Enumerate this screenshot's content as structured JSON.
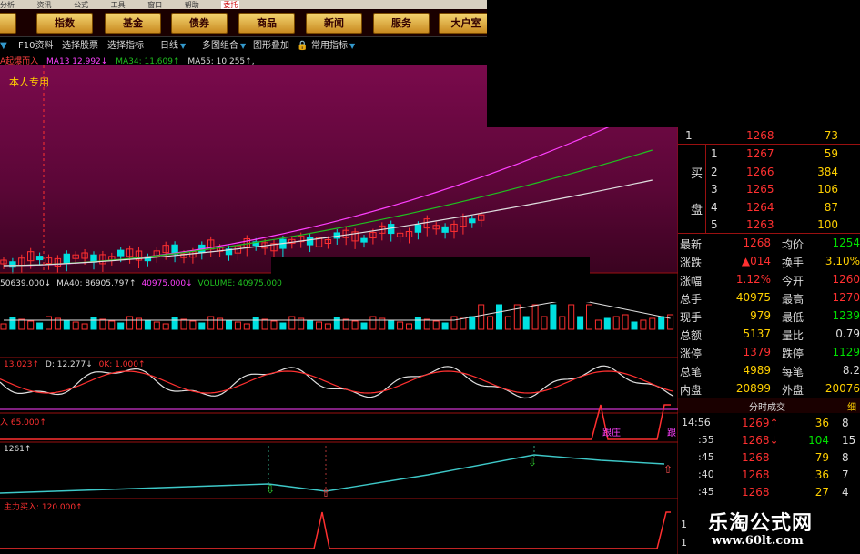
{
  "menu": [
    "分析",
    "资讯",
    "公式",
    "工具",
    "窗口",
    "帮助"
  ],
  "menu_badge": "委托",
  "nav": [
    "",
    "指数",
    "基金",
    "债券",
    "商品",
    "新闻",
    "服务",
    "大户室"
  ],
  "toolbar": {
    "items": [
      "F10资料",
      "选择股票",
      "选择指标",
      "日线",
      "多图组合",
      "图形叠加",
      "常用指标"
    ]
  },
  "main_info": {
    "formula": "A起爆而入",
    "ma13": "MA13  12.992↓",
    "ma34": "MA34: 11.609↑",
    "ma55": "MA55: 10.255↑,"
  },
  "main_label": "本人专用",
  "volume_info": {
    "a": "50639.000↓",
    "ma40": "MA40: 86905.797↑",
    "c": "40975.000↓",
    "vol": "VOLUME: 40975.000"
  },
  "kdj_info": {
    "k": "13.023↑",
    "d": "D: 12.277↓",
    "j": "0K: 1.000↑"
  },
  "ind3_info": "入  65.000↑",
  "ind3_labels": [
    "跟庄",
    "跟"
  ],
  "ind4_info": "1261↑",
  "ind5_info": "主力买入: 120.000↑",
  "order_book": {
    "buy_label": [
      "买",
      "盘"
    ],
    "top_row": {
      "level": "1",
      "price": "1268",
      "vol": "73"
    },
    "buys": [
      {
        "level": "1",
        "price": "1267",
        "vol": "59"
      },
      {
        "level": "2",
        "price": "1266",
        "vol": "384"
      },
      {
        "level": "3",
        "price": "1265",
        "vol": "106"
      },
      {
        "level": "4",
        "price": "1264",
        "vol": "87"
      },
      {
        "level": "5",
        "price": "1263",
        "vol": "100"
      }
    ]
  },
  "quote": [
    {
      "l": "最新",
      "v": "1268",
      "l2": "均价",
      "v2": "1254"
    },
    {
      "l": "涨跌",
      "v": "▲014",
      "l2": "换手",
      "v2": "3.10%"
    },
    {
      "l": "涨幅",
      "v": "1.12%",
      "l2": "今开",
      "v2": "1260"
    },
    {
      "l": "总手",
      "v": "40975",
      "l2": "最高",
      "v2": "1270"
    },
    {
      "l": "现手",
      "v": "979",
      "l2": "最低",
      "v2": "1239"
    },
    {
      "l": "总额",
      "v": "5137",
      "l2": "量比",
      "v2": "0.79"
    },
    {
      "l": "涨停",
      "v": "1379",
      "l2": "跌停",
      "v2": "1129"
    },
    {
      "l": "总笔",
      "v": "4989",
      "l2": "每笔",
      "v2": "8.2"
    },
    {
      "l": "内盘",
      "v": "20899",
      "l2": "外盘",
      "v2": "20076"
    }
  ],
  "ticks_header": {
    "title": "分时成交",
    "right": "细"
  },
  "ticks": [
    {
      "time": "14:56",
      "price": "1269↑",
      "vol": "36",
      "n": "8"
    },
    {
      "time": ":55",
      "price": "1268↓",
      "vol": "104",
      "n": "15"
    },
    {
      "time": ":45",
      "price": "1268",
      "vol": "79",
      "n": "8"
    },
    {
      "time": ":40",
      "price": "1268",
      "vol": "36",
      "n": "7"
    },
    {
      "time": ":45",
      "price": "1268",
      "vol": "27",
      "n": "4"
    }
  ],
  "bottom_left": [
    "1",
    "1"
  ],
  "watermark": {
    "line1": "乐淘公式网",
    "line2": "www.60lt.com"
  },
  "colors": {
    "up": "#ff3030",
    "down": "#00e0e0",
    "ma13": "#ff40ff",
    "ma34": "#20c020",
    "ma55": "#e0e0e0",
    "bg_chart": "#5a0636",
    "sep": "#9a1010"
  }
}
